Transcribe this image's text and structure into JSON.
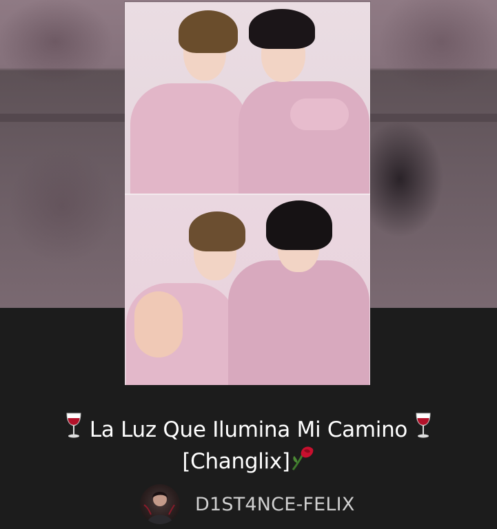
{
  "story": {
    "title_line1": "La Luz Que Ilumina Mi Camino",
    "title_line2": "[Changlix]",
    "title_emoji_left": "wine-glass",
    "title_emoji_right": "wine-glass",
    "title_emoji_end": "wilted-rose",
    "author": "D1ST4NCE-FELIX"
  },
  "colors": {
    "background": "#1c1c1c",
    "title_text": "#ffffff",
    "author_text": "#d0d0d0",
    "pink_shirt": "#e7b9cb"
  }
}
